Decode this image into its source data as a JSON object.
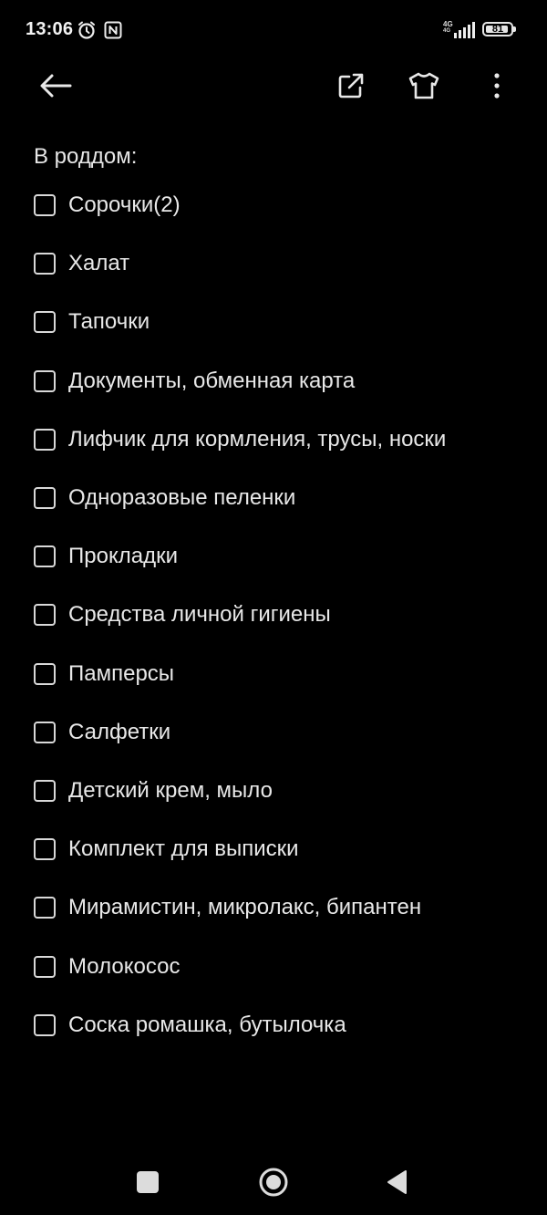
{
  "status_bar": {
    "time": "13:06",
    "network": "4G",
    "network_sub": "4G",
    "battery": "81",
    "icons": [
      "alarm-icon",
      "nfc-icon",
      "signal-icon",
      "battery-icon"
    ]
  },
  "toolbar": {
    "icons": [
      "back-arrow-icon",
      "share-icon",
      "theme-shirt-icon",
      "more-vert-icon"
    ]
  },
  "note": {
    "heading": "В роддом:",
    "items": [
      {
        "label": "Сорочки(2)",
        "checked": false
      },
      {
        "label": "Халат",
        "checked": false
      },
      {
        "label": "Тапочки",
        "checked": false
      },
      {
        "label": "Документы, обменная карта",
        "checked": false
      },
      {
        "label": "Лифчик для кормления, трусы, носки",
        "checked": false
      },
      {
        "label": "Одноразовые пеленки",
        "checked": false
      },
      {
        "label": "Прокладки",
        "checked": false
      },
      {
        "label": "Средства личной гигиены",
        "checked": false
      },
      {
        "label": "Памперсы",
        "checked": false
      },
      {
        "label": "Салфетки",
        "checked": false
      },
      {
        "label": "Детский крем, мыло",
        "checked": false
      },
      {
        "label": "Комплект для выписки",
        "checked": false
      },
      {
        "label": "Мирамистин, микролакс, бипантен",
        "checked": false
      },
      {
        "label": "Молокосос",
        "checked": false
      },
      {
        "label": "Соска ромашка, бутылочка",
        "checked": false
      }
    ]
  },
  "nav_bar": {
    "icons": [
      "recents-square-icon",
      "home-circle-icon",
      "back-triangle-icon"
    ]
  },
  "colors": {
    "background": "#000000",
    "text": "#e8e8e8",
    "checkbox_border": "#d9d9d9"
  }
}
